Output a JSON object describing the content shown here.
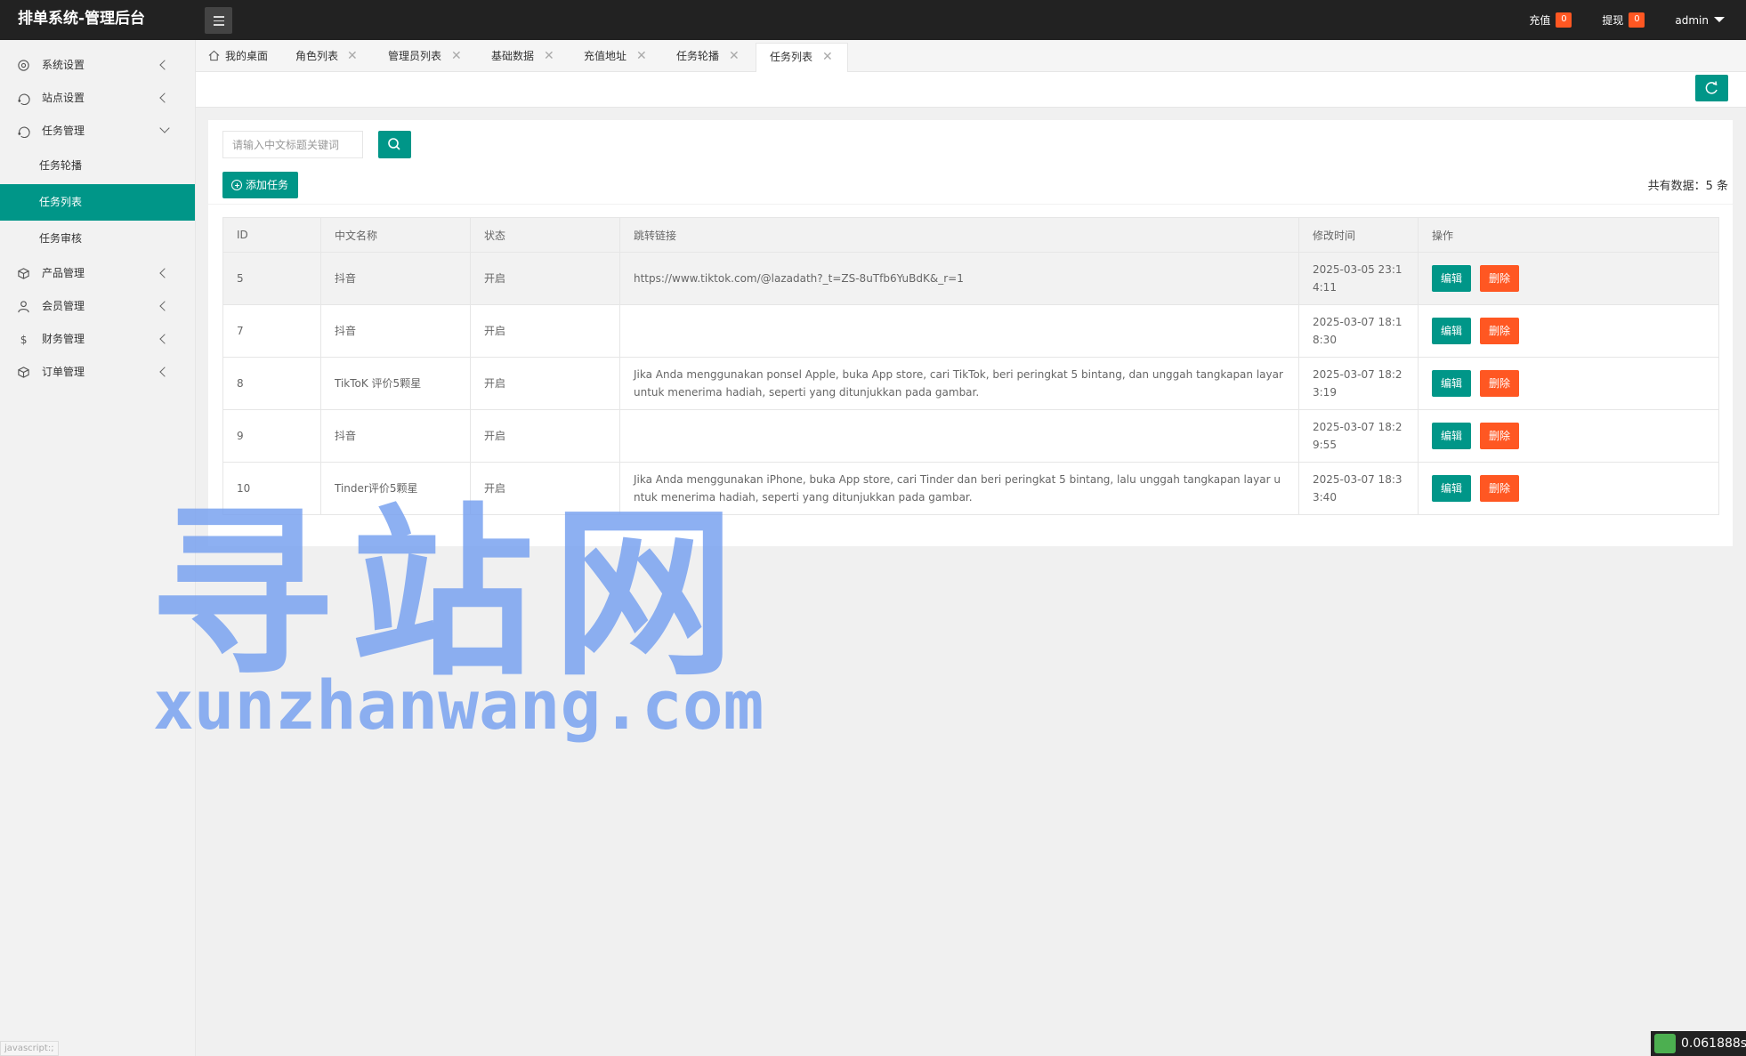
{
  "header": {
    "title": "排单系统-管理后台",
    "recharge_label": "充值",
    "recharge_count": "0",
    "withdraw_label": "提现",
    "withdraw_count": "0",
    "user": "admin"
  },
  "sidebar": {
    "items": [
      {
        "label": "系统设置",
        "icon": "gear-icon"
      },
      {
        "label": "站点设置",
        "icon": "site-icon"
      },
      {
        "label": "任务管理",
        "icon": "task-icon"
      },
      {
        "label": "产品管理",
        "icon": "product-icon"
      },
      {
        "label": "会员管理",
        "icon": "user-icon"
      },
      {
        "label": "财务管理",
        "icon": "dollar-icon"
      },
      {
        "label": "订单管理",
        "icon": "order-icon"
      }
    ],
    "sub_items": [
      "任务轮播",
      "任务列表",
      "任务审核"
    ]
  },
  "tabs": [
    "我的桌面",
    "角色列表",
    "管理员列表",
    "基础数据",
    "充值地址",
    "任务轮播",
    "任务列表"
  ],
  "search": {
    "placeholder": "请输入中文标题关键词"
  },
  "add_button": "添加任务",
  "count_text": "共有数据：5 条",
  "table": {
    "headers": [
      "ID",
      "中文名称",
      "状态",
      "跳转链接",
      "修改时间",
      "操作"
    ],
    "edit_label": "编辑",
    "delete_label": "删除",
    "rows": [
      {
        "id": "5",
        "name": "抖音",
        "status": "开启",
        "link": "https://www.tiktok.com/@lazadath?_t=ZS-8uTfb6YuBdK&_r=1",
        "time": "2025-03-05 23:14:11"
      },
      {
        "id": "7",
        "name": "抖音",
        "status": "开启",
        "link": "",
        "time": "2025-03-07 18:18:30"
      },
      {
        "id": "8",
        "name": "TikToK 评价5颗星",
        "status": "开启",
        "link": "Jika Anda menggunakan ponsel Apple, buka App store, cari TikTok, beri peringkat 5 bintang, dan unggah tangkapan layar untuk menerima hadiah, seperti yang ditunjukkan pada gambar.",
        "time": "2025-03-07 18:23:19"
      },
      {
        "id": "9",
        "name": "抖音",
        "status": "开启",
        "link": "",
        "time": "2025-03-07 18:29:55"
      },
      {
        "id": "10",
        "name": "Tinder评价5颗星",
        "status": "开启",
        "link": "Jika Anda menggunakan iPhone, buka App store, cari Tinder dan beri peringkat 5 bintang, lalu unggah tangkapan layar untuk menerima hadiah, seperti yang ditunjukkan pada gambar.",
        "time": "2025-03-07 18:33:40"
      }
    ]
  },
  "watermark": {
    "cn": "寻站网",
    "en": "xunzhanwang.com"
  },
  "status_bar": "javascript:;",
  "timer": "0.061888s",
  "colors": {
    "primary": "#009688",
    "danger": "#ff5722",
    "header": "#222222"
  }
}
